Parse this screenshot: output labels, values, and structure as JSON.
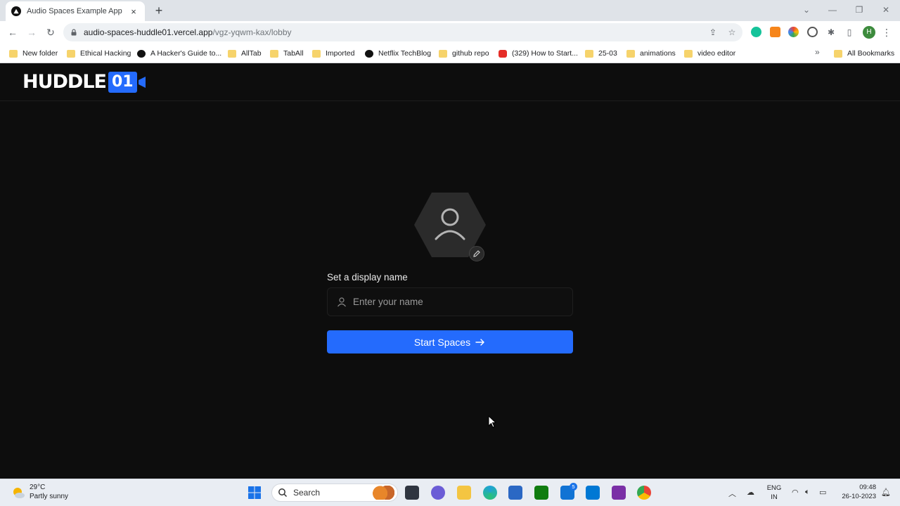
{
  "browser": {
    "tab_title": "Audio Spaces Example App",
    "tab_close": "×",
    "new_tab": "+",
    "window_controls": {
      "minimize": "—",
      "restore": "❐",
      "close": "✕"
    },
    "url_host": "audio-spaces-huddle01.vercel.app",
    "url_path": "/vgz-yqwm-kax/lobby",
    "profile_initial": "H",
    "bookmarks": [
      {
        "label": "New folder",
        "icon": "folder-icon"
      },
      {
        "label": "Ethical Hacking",
        "icon": "folder-icon"
      },
      {
        "label": "A Hacker's Guide to...",
        "icon": "medium-icon"
      },
      {
        "label": "AllTab",
        "icon": "folder-icon"
      },
      {
        "label": "TabAll",
        "icon": "folder-icon"
      },
      {
        "label": "Imported",
        "icon": "folder-icon"
      },
      {
        "label": "Netflix TechBlog",
        "icon": "medium-icon"
      },
      {
        "label": "github repo",
        "icon": "folder-icon"
      },
      {
        "label": "(329) How to Start...",
        "icon": "youtube-icon"
      },
      {
        "label": "25-03",
        "icon": "folder-icon"
      },
      {
        "label": "animations",
        "icon": "folder-icon"
      },
      {
        "label": "video editor",
        "icon": "folder-icon"
      }
    ],
    "bookmarks_overflow": "»",
    "all_bookmarks": "All Bookmarks"
  },
  "app": {
    "logo_word": "HUDDLE",
    "logo_number": "01",
    "display_name_label": "Set a display name",
    "name_placeholder": "Enter your name",
    "name_value": "",
    "start_button_label": "Start Spaces",
    "colors": {
      "accent": "#246bfd",
      "background": "#0d0d0d"
    }
  },
  "taskbar": {
    "weather_temp": "29°C",
    "weather_desc": "Partly sunny",
    "search_label": "Search",
    "mail_badge": "5",
    "lang_top": "ENG",
    "lang_bottom": "IN",
    "time": "09:48",
    "date": "26-10-2023"
  }
}
